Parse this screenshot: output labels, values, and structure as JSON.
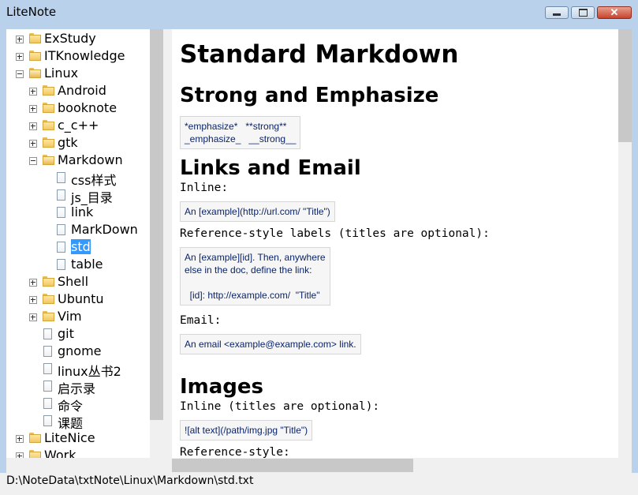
{
  "window": {
    "title": "LiteNote",
    "minimize_label": "",
    "maximize_label": "",
    "close_label": "✕"
  },
  "tree": {
    "items": [
      {
        "label": "ExStudy",
        "kind": "folder",
        "expander": "plus"
      },
      {
        "label": "ITKnowledge",
        "kind": "folder",
        "expander": "plus"
      },
      {
        "label": "Linux",
        "kind": "folder-open",
        "expander": "minus"
      },
      {
        "label": "Android",
        "kind": "folder",
        "expander": "plus"
      },
      {
        "label": "booknote",
        "kind": "folder",
        "expander": "plus"
      },
      {
        "label": "c_c++",
        "kind": "folder",
        "expander": "plus"
      },
      {
        "label": "gtk",
        "kind": "folder",
        "expander": "plus"
      },
      {
        "label": "Markdown",
        "kind": "folder-open",
        "expander": "minus"
      },
      {
        "label": "css样式",
        "kind": "document"
      },
      {
        "label": "js_目录",
        "kind": "document"
      },
      {
        "label": "link",
        "kind": "document"
      },
      {
        "label": "MarkDown",
        "kind": "document"
      },
      {
        "label": "std",
        "kind": "document",
        "selected": true
      },
      {
        "label": "table",
        "kind": "document"
      },
      {
        "label": "Shell",
        "kind": "folder",
        "expander": "plus"
      },
      {
        "label": "Ubuntu",
        "kind": "folder",
        "expander": "plus"
      },
      {
        "label": "Vim",
        "kind": "folder",
        "expander": "plus"
      },
      {
        "label": "git",
        "kind": "document"
      },
      {
        "label": "gnome",
        "kind": "document"
      },
      {
        "label": "linux丛书2",
        "kind": "document"
      },
      {
        "label": "启示录",
        "kind": "document"
      },
      {
        "label": "命令",
        "kind": "document"
      },
      {
        "label": "课题",
        "kind": "document"
      },
      {
        "label": "LiteNice",
        "kind": "folder",
        "expander": "plus"
      },
      {
        "label": "Work",
        "kind": "folder",
        "expander": "plus"
      }
    ]
  },
  "document": {
    "h1": "Standard Markdown",
    "strong_heading": "Strong and Emphasize",
    "strong_code": "*emphasize*   **strong**\n_emphasize_   __strong__",
    "links_heading": "Links and Email",
    "inline_label": "Inline:",
    "inline_code": "An [example](http://url.com/ \"Title\")",
    "ref_label": "Reference-style labels (titles are optional):",
    "ref_code": "An [example][id]. Then, anywhere\nelse in the doc, define the link:\n\n  [id]: http://example.com/  \"Title\"",
    "email_label": "Email:",
    "email_code": "An email <example@example.com> link.",
    "images_heading": "Images",
    "images_inline_label": "Inline (titles are optional):",
    "images_inline_code": "![alt text](/path/img.jpg \"Title\")",
    "images_ref_label": "Reference-style:"
  },
  "status": {
    "path": "D:\\NoteData\\txtNote\\Linux\\Markdown\\std.txt"
  },
  "colors": {
    "title_bar": "#b9d1ea",
    "selection": "#3399ff",
    "code_text": "#0a246a"
  }
}
